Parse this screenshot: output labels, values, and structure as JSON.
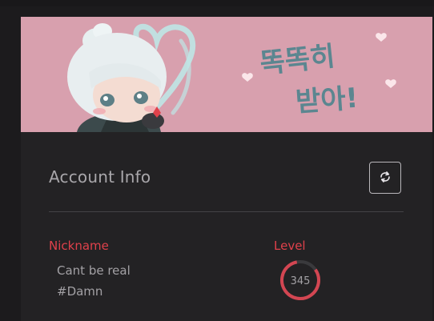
{
  "banner": {
    "korean_text_line1": "똑똑히",
    "korean_text_line2": "받아!"
  },
  "account": {
    "title": "Account Info",
    "refresh_icon": "refresh-icon",
    "nickname_label": "Nickname",
    "nickname": "Cant be real",
    "tag": "#Damn",
    "level_label": "Level",
    "level": "345"
  },
  "colors": {
    "banner_bg": "#d8a0ae",
    "accent_red": "#e0414b",
    "card_bg": "#232224",
    "page_bg": "#1c1b1d"
  }
}
